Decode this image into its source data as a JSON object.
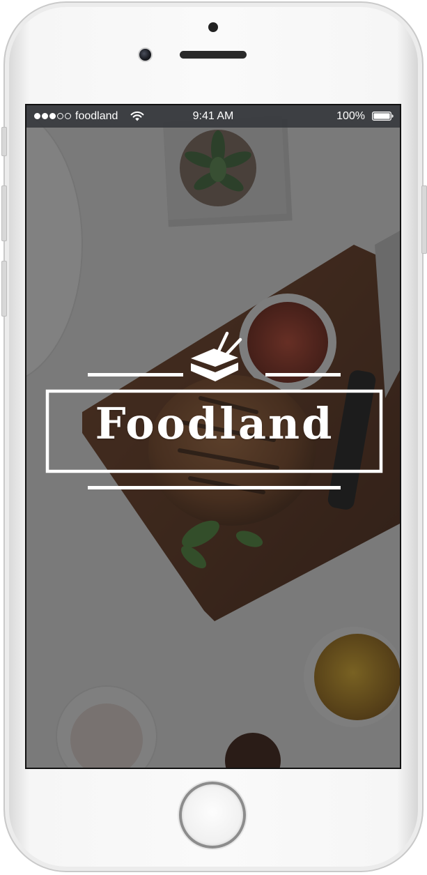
{
  "device": {
    "model": "iphone-white",
    "home_button_icon": "home-button-icon"
  },
  "status_bar": {
    "signal_bars_filled": 3,
    "signal_bars_total": 5,
    "carrier": "foodland",
    "wifi_icon": "wifi-icon",
    "time": "9:41 AM",
    "battery_percent": "100%",
    "battery_icon": "battery-icon"
  },
  "splash": {
    "logo_icon": "food-box-with-chopsticks-icon",
    "app_name": "Foodland",
    "background": "food-photo-burger-on-cutting-board",
    "overlay_color": "#1e1e1e"
  },
  "colors": {
    "status_bar_bg": "#373a3e",
    "logo_color": "#ffffff",
    "board_wood": "#6b3b22",
    "table_white": "#efefef"
  }
}
